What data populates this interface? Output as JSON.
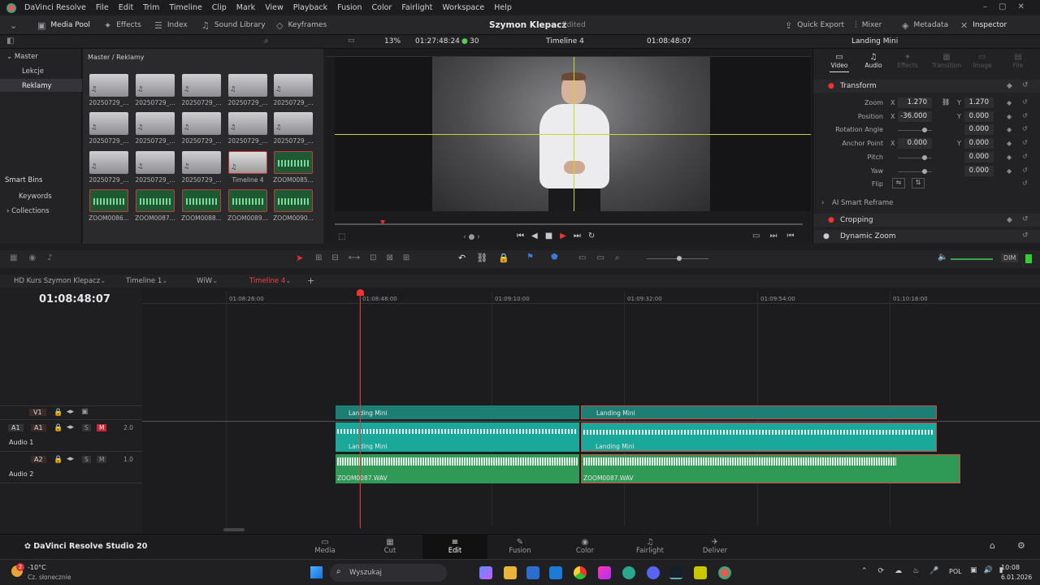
{
  "menu": {
    "app": "DaVinci Resolve",
    "items": [
      "File",
      "Edit",
      "Trim",
      "Timeline",
      "Clip",
      "Mark",
      "View",
      "Playback",
      "Fusion",
      "Color",
      "Fairlight",
      "Workspace",
      "Help"
    ]
  },
  "toolbar": {
    "media_pool": "Media Pool",
    "effects": "Effects",
    "index": "Index",
    "sound_library": "Sound Library",
    "keyframes": "Keyframes",
    "project": "Szymon Klepacz",
    "status": "Edited",
    "quick_export": "Quick Export",
    "mixer": "Mixer",
    "metadata": "Metadata",
    "inspector": "Inspector"
  },
  "viewerbar": {
    "zoom": "13%",
    "timecode": "01:27:48:24",
    "fps": "30",
    "timeline": "Timeline 4",
    "current_tc": "01:08:48:07",
    "clip": "Landing Mini"
  },
  "media_pool": {
    "bins": [
      "Master",
      "Lekcje",
      "Reklamy"
    ],
    "smart_bins": "Smart Bins",
    "smart_items": [
      "Keywords",
      "Collections"
    ],
    "path": "Master / Reklamy",
    "items": [
      "20250729_...",
      "20250729_...",
      "20250729_...",
      "20250729_...",
      "20250729_...",
      "20250729_...",
      "20250729_...",
      "20250729_...",
      "20250729_...",
      "20250729_...",
      "20250729_...",
      "20250729_...",
      "20250729_...",
      "Timeline 4",
      "ZOOM0085...",
      "ZOOM0086...",
      "ZOOM0087...",
      "ZOOM0088...",
      "ZOOM0089...",
      "ZOOM0090..."
    ]
  },
  "inspector": {
    "tabs": [
      "Video",
      "Audio",
      "Effects",
      "Transition",
      "Image",
      "File"
    ],
    "transform": "Transform",
    "zoom_label": "Zoom",
    "zoom_x": "1.270",
    "zoom_y": "1.270",
    "position_label": "Position",
    "pos_x": "-36.000",
    "pos_y": "0.000",
    "rotation_label": "Rotation Angle",
    "rotation": "0.000",
    "anchor_label": "Anchor Point",
    "anchor_x": "0.000",
    "anchor_y": "0.000",
    "pitch_label": "Pitch",
    "pitch": "0.000",
    "yaw_label": "Yaw",
    "yaw": "0.000",
    "flip_label": "Flip",
    "ai_reframe": "AI Smart Reframe",
    "cropping": "Cropping",
    "dynamic_zoom": "Dynamic Zoom",
    "x": "X",
    "y": "Y"
  },
  "timeline": {
    "tabs": [
      "HD Kurs Szymon Klepacz",
      "Timeline 1",
      "WiW",
      "Timeline 4"
    ],
    "timecode": "01:08:48:07",
    "ruler": [
      "01:08:26:00",
      "01:08:48:00",
      "01:09:10:00",
      "01:09:32:00",
      "01:09:54:00",
      "01:10:16:00"
    ],
    "dim": "DIM",
    "tracks": {
      "v1": "V1",
      "a1": "A1",
      "audio1": "Audio 1",
      "a1_level": "2.0",
      "a2": "A2",
      "audio2": "Audio 2",
      "a2_level": "1.0",
      "s": "S",
      "m": "M"
    },
    "clips": {
      "video1": "Landing Mini",
      "video2": "Landing Mini",
      "audio1a": "Landing Mini",
      "audio1b": "Landing Mini",
      "audio2a": "ZOOM0087.WAV",
      "audio2b": "ZOOM0087.WAV"
    }
  },
  "pages": {
    "brand": "DaVinci Resolve Studio 20",
    "items": [
      "Media",
      "Cut",
      "Edit",
      "Fusion",
      "Color",
      "Fairlight",
      "Deliver"
    ]
  },
  "taskbar": {
    "temp": "-10°C",
    "weather": "Cz. słonecznie",
    "search": "Wyszukaj",
    "lang": "POL",
    "time": "10:08",
    "date": "6.01.2026",
    "badge": "2"
  }
}
